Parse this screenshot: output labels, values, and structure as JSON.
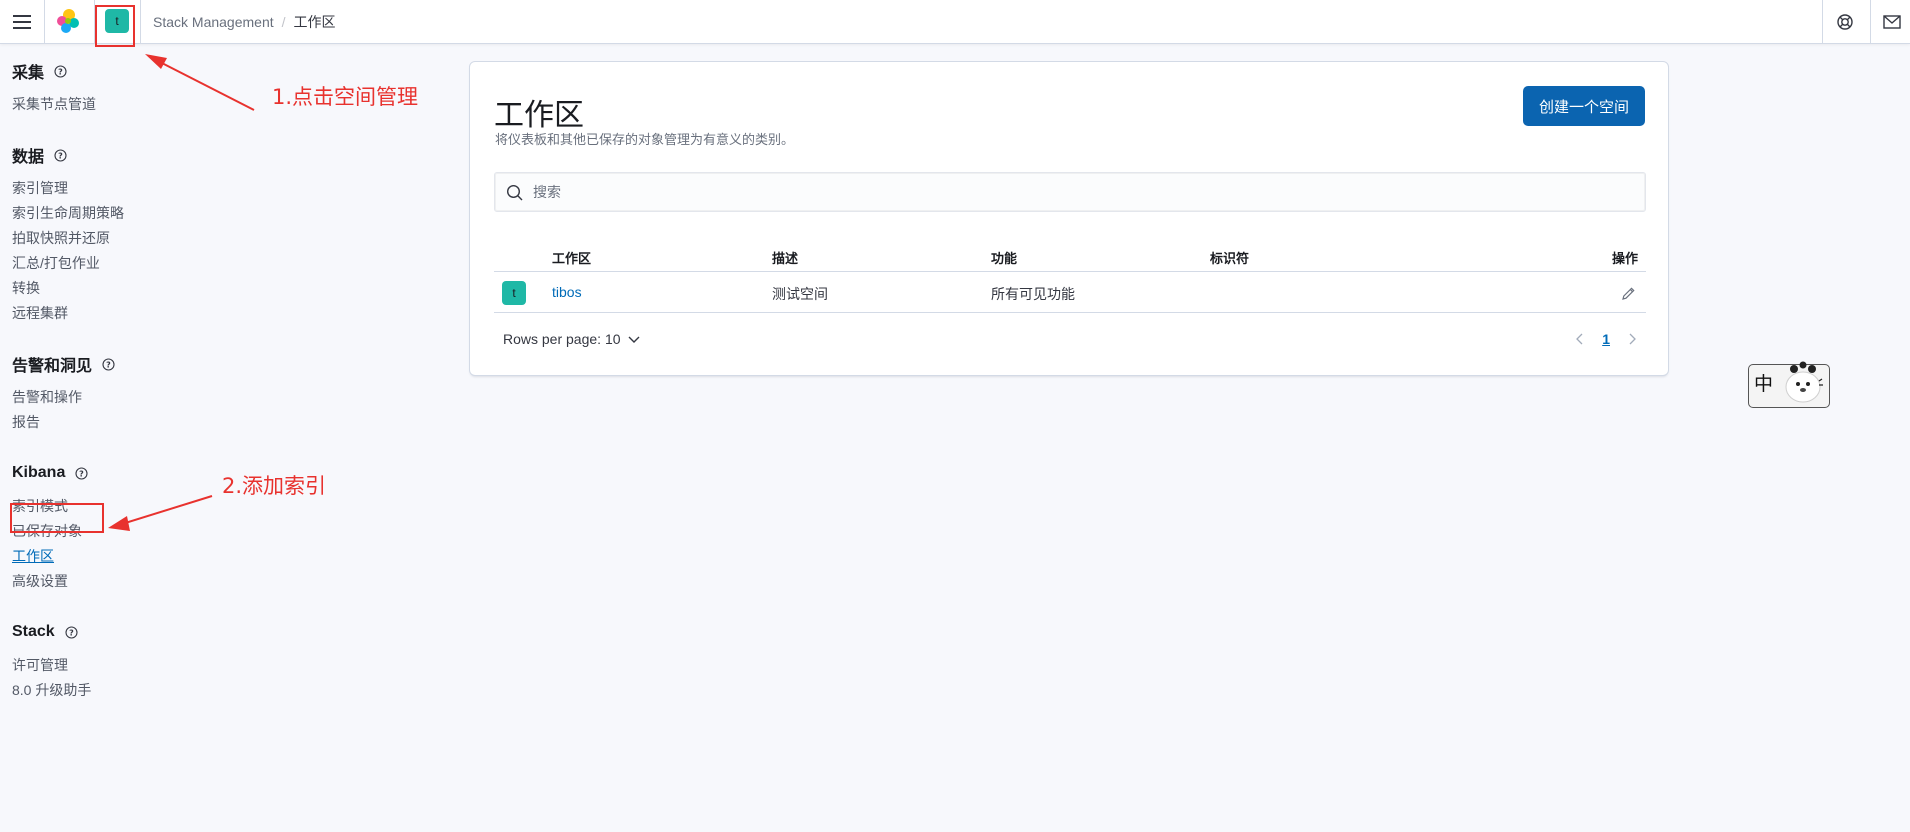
{
  "header": {
    "menu_icon": "hamburger-menu-icon",
    "logo_icon": "elastic-cluster-logo-icon",
    "space_avatar_letter": "t",
    "space_avatar_color": "#1fb8a6",
    "breadcrumbs": [
      "Stack Management",
      "工作区"
    ],
    "right_icons": [
      "help-lifebuoy-icon",
      "newsfeed-mail-icon"
    ]
  },
  "annotations": {
    "step1": "1.点击空间管理",
    "step2": "2.添加索引",
    "color": "#e8322e"
  },
  "sidebar": {
    "groups": [
      {
        "title": "采集",
        "items": [
          "采集节点管道"
        ]
      },
      {
        "title": "数据",
        "items": [
          "索引管理",
          "索引生命周期策略",
          "拍取快照并还原",
          "汇总/打包作业",
          "转换",
          "远程集群"
        ]
      },
      {
        "title": "告警和洞见",
        "items": [
          "告警和操作",
          "报告"
        ]
      },
      {
        "title": "Kibana",
        "items": [
          "索引模式",
          "已保存对象",
          "工作区",
          "高级设置"
        ],
        "active_index": 2
      },
      {
        "title": "Stack",
        "items": [
          "许可管理",
          "8.0 升级助手"
        ]
      }
    ]
  },
  "main": {
    "title": "工作区",
    "description": "将仪表板和其他已保存的对象管理为有意义的类别。",
    "create_button": "创建一个空间",
    "search_placeholder": "搜索",
    "table": {
      "columns": [
        "工作区",
        "描述",
        "功能",
        "标识符",
        "操作"
      ],
      "rows": [
        {
          "avatar": "t",
          "name": "tibos",
          "description": "测试空间",
          "features": "所有可见功能",
          "identifier": "",
          "action_icon": "edit-pencil-icon"
        }
      ]
    },
    "rows_per_page": "Rows per page: 10",
    "pagination": {
      "current_page": "1"
    }
  },
  "ime": {
    "char": "中"
  },
  "colors": {
    "accent": "#006bb8",
    "primary_button": "#0b64b0",
    "page_bg": "#f7f8fc"
  }
}
